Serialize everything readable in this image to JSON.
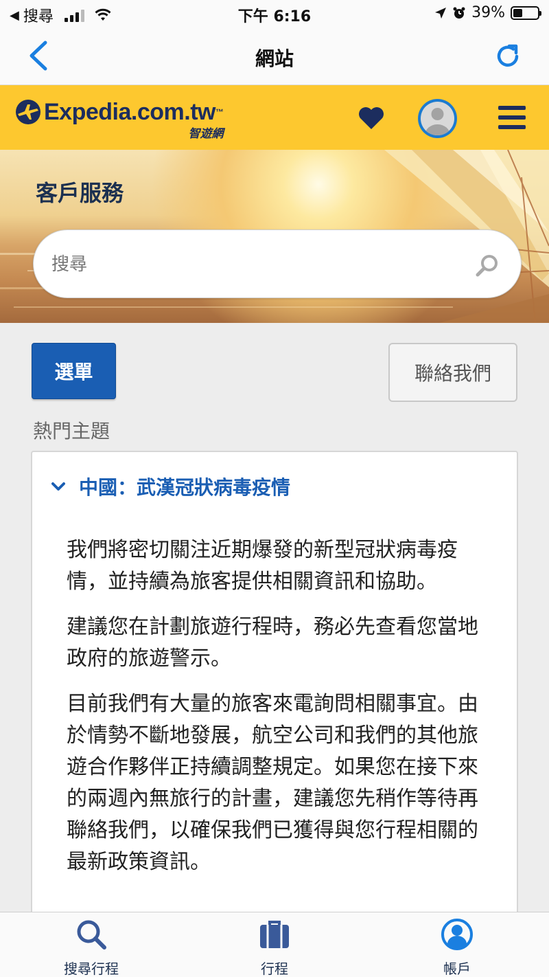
{
  "status_bar": {
    "back_app": "搜尋",
    "time": "下午 6:16",
    "battery": "39%",
    "battery_level": 0.39
  },
  "nav": {
    "title": "網站"
  },
  "brand": {
    "logo_main": "Expedia.com.tw",
    "logo_tm": "™",
    "logo_sub": "智遊網",
    "color": "#fdc82f",
    "navy": "#1c2d5e"
  },
  "hero": {
    "title": "客戶服務",
    "search_placeholder": "搜尋"
  },
  "actions": {
    "menu_label": "選單",
    "contact_label": "聯絡我們"
  },
  "topics": {
    "label": "熱門主題",
    "card_title": "中國：武漢冠狀病毒疫情",
    "paragraphs": [
      "我們將密切關注近期爆發的新型冠狀病毒疫情，並持續為旅客提供相關資訊和協助。",
      "建議您在計劃旅遊行程時，務必先查看您當地政府的旅遊警示。",
      "目前我們有大量的旅客來電詢問相關事宜。由於情勢不斷地發展，航空公司和我們的其他旅遊合作夥伴正持續調整規定。如果您在接下來的兩週內無旅行的計畫，建議您先稍作等待再聯絡我們，以確保我們已獲得與您行程相關的最新政策資訊。"
    ]
  },
  "tabs": [
    {
      "label": "搜尋行程",
      "icon": "search-icon"
    },
    {
      "label": "行程",
      "icon": "suitcase-icon"
    },
    {
      "label": "帳戶",
      "icon": "account-icon",
      "active": true
    }
  ],
  "colors": {
    "primary_blue": "#1a5eb3",
    "tab_icon_blue": "#3a5a9a",
    "active_blue": "#1a7fe0"
  }
}
